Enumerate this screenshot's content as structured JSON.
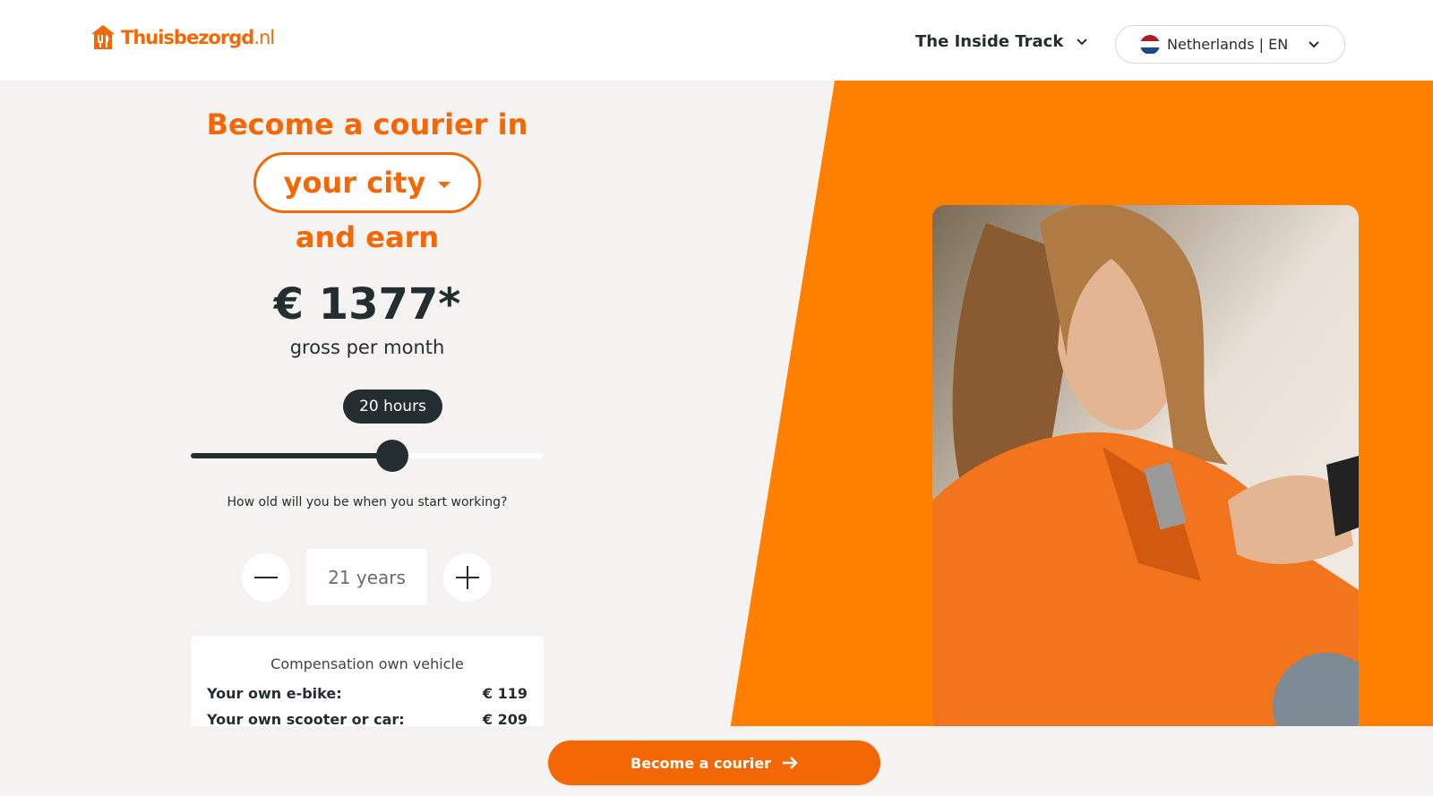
{
  "header": {
    "logo_text": "Thuisbezorgd",
    "logo_suffix": ".nl",
    "nav_item": "The Inside Track",
    "language_selector": "Netherlands | EN"
  },
  "calculator": {
    "title_line1": "Become a courier in",
    "city_select": "your city",
    "title_line3": "and earn",
    "amount": "€ 1377*",
    "period": "gross per month",
    "hours_label": "20 hours",
    "hours_fraction": 0.57,
    "age_question": "How old will you be when you start working?",
    "age_value": "21 years"
  },
  "compensation": {
    "title": "Compensation own vehicle",
    "rows": [
      {
        "label": "Your own e-bike:",
        "value": "€ 119"
      },
      {
        "label": "Your own scooter or car:",
        "value": "€ 209"
      }
    ]
  },
  "cta": {
    "label": "Become a courier"
  },
  "colors": {
    "brand": "#f36805",
    "dark": "#242e30",
    "background": "#f5f3f1"
  }
}
